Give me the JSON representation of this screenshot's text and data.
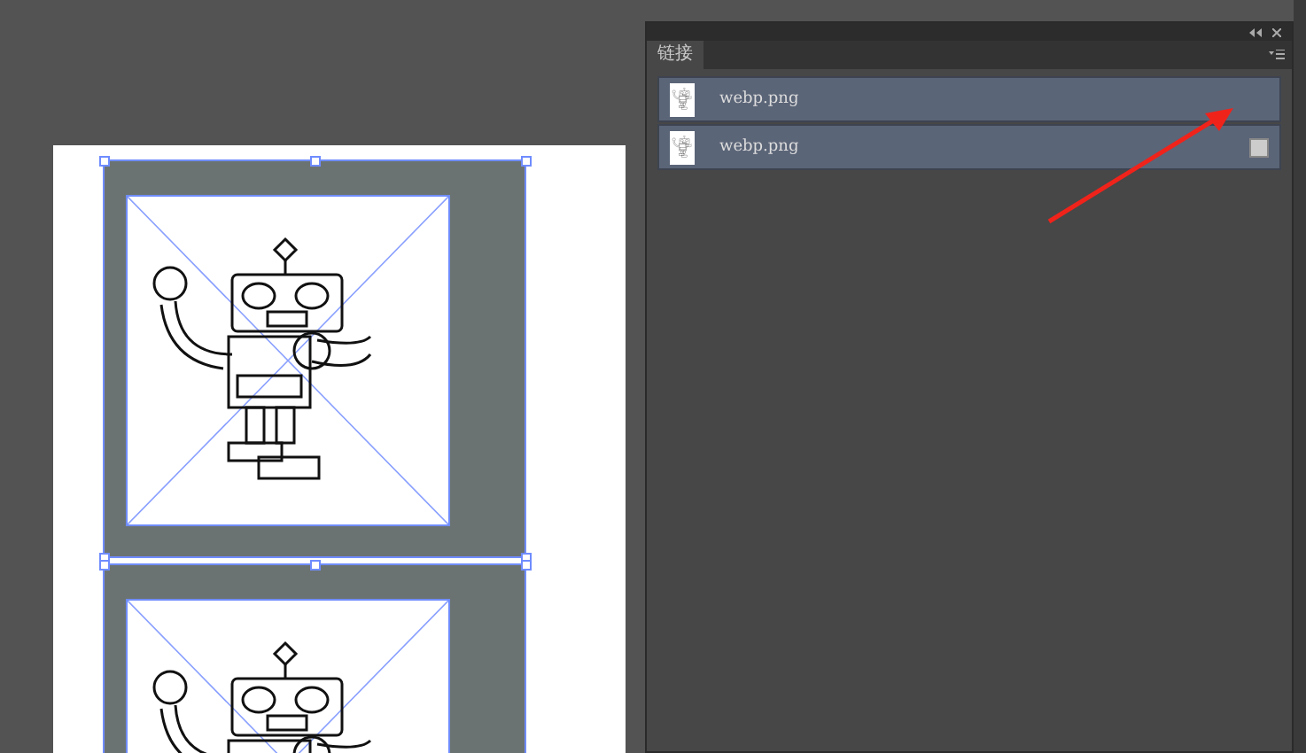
{
  "panel": {
    "tab": {
      "label": "链接",
      "selected": true
    },
    "links": [
      {
        "name": "webp.png",
        "selected": true,
        "embedded": false
      },
      {
        "name": "webp.png",
        "selected": true,
        "embedded": true
      }
    ]
  },
  "canvas": {
    "frames": [
      {
        "selected": true
      },
      {
        "selected": true
      }
    ]
  }
}
